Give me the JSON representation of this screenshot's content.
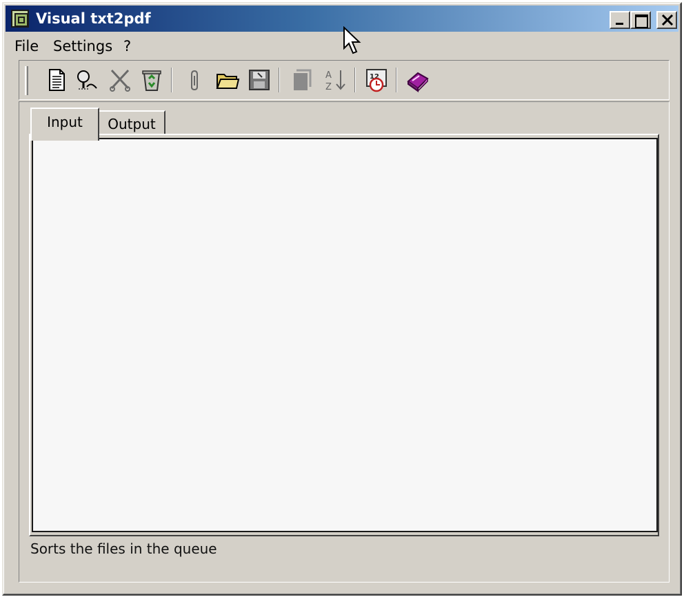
{
  "window": {
    "title": "Visual txt2pdf",
    "icon": "app-icon",
    "title_gradient": [
      "#0a246a",
      "#a6caf0"
    ]
  },
  "menu": {
    "items": [
      {
        "label": "File"
      },
      {
        "label": "Settings"
      },
      {
        "label": "?"
      }
    ]
  },
  "toolbar": {
    "buttons": [
      {
        "icon": "new-document-icon"
      },
      {
        "icon": "find-icon"
      },
      {
        "icon": "cut-icon"
      },
      {
        "icon": "recycle-bin-icon"
      },
      {
        "icon": "attach-icon"
      },
      {
        "icon": "open-folder-icon"
      },
      {
        "icon": "save-disk-icon"
      },
      {
        "icon": "copy-icon"
      },
      {
        "icon": "sort-az-icon"
      },
      {
        "icon": "schedule-icon"
      },
      {
        "icon": "help-book-icon"
      }
    ]
  },
  "tabs": [
    {
      "label": "Input",
      "selected": true
    },
    {
      "label": "Output",
      "selected": false
    }
  ],
  "status": {
    "text": "Sorts the files in the queue"
  }
}
